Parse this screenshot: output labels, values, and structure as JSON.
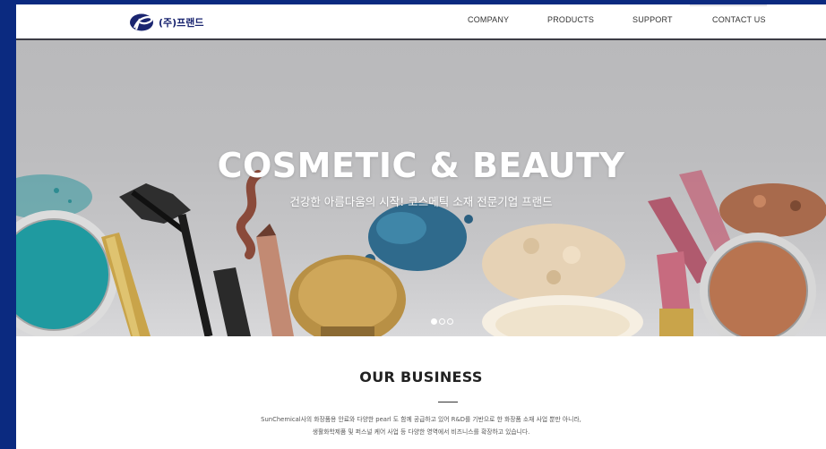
{
  "brand": {
    "name": "(주)프랜드",
    "colors": {
      "frame": "#0b2a80",
      "logo": "#1a2570"
    }
  },
  "nav": {
    "items": [
      {
        "label": "COMPANY"
      },
      {
        "label": "PRODUCTS"
      },
      {
        "label": "SUPPORT"
      },
      {
        "label": "CONTACT US"
      }
    ]
  },
  "hero": {
    "title": "COSMETIC & BEAUTY",
    "subtitle": "건강한 아름다움의 시작! 코스메틱 소재 전문기업 프랜드",
    "slides_total": 3,
    "active_slide": 1
  },
  "business": {
    "title": "OUR BUSINESS",
    "description_line1": "SunChemical사의 화장품용 안료와 다양한 pearl 도 함께 공급하고 있어 R&D를 기반으로 한 화장품 소재 사업 뿐만 아니라,",
    "description_line2": "생활화학제품 및 퍼스널 케어 사업 등 다양한 영역에서 비즈니스를 확장하고 있습니다."
  }
}
